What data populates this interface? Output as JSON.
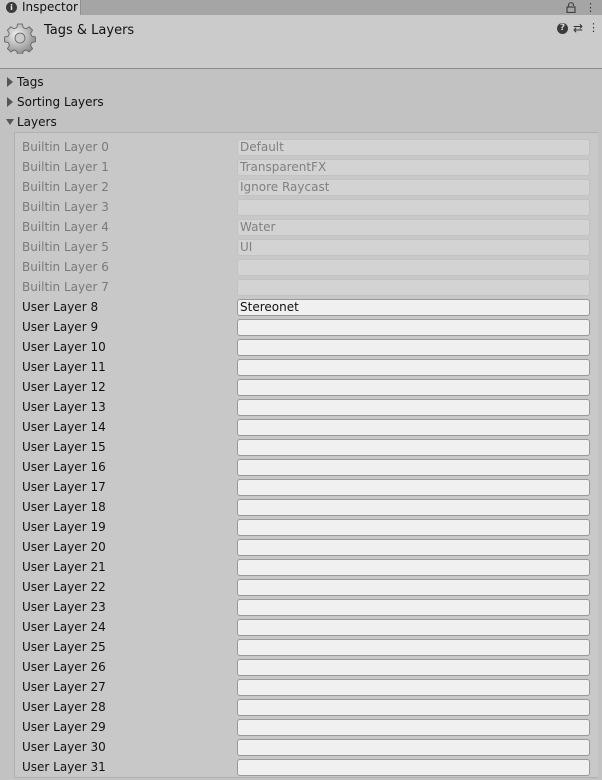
{
  "tab": {
    "label": "Inspector",
    "info_icon": "i",
    "menu_glyph": "⋮"
  },
  "header": {
    "title": "Tags & Layers",
    "help_glyph": "?",
    "preset_glyph": "⇄",
    "menu_glyph": "⋮"
  },
  "sections": {
    "tags": "Tags",
    "sorting_layers": "Sorting Layers",
    "layers": "Layers"
  },
  "layers": [
    {
      "label": "Builtin Layer 0",
      "value": "Default",
      "builtin": true
    },
    {
      "label": "Builtin Layer 1",
      "value": "TransparentFX",
      "builtin": true
    },
    {
      "label": "Builtin Layer 2",
      "value": "Ignore Raycast",
      "builtin": true
    },
    {
      "label": "Builtin Layer 3",
      "value": "",
      "builtin": true
    },
    {
      "label": "Builtin Layer 4",
      "value": "Water",
      "builtin": true
    },
    {
      "label": "Builtin Layer 5",
      "value": "UI",
      "builtin": true
    },
    {
      "label": "Builtin Layer 6",
      "value": "",
      "builtin": true
    },
    {
      "label": "Builtin Layer 7",
      "value": "",
      "builtin": true
    },
    {
      "label": "User Layer 8",
      "value": "Stereonet",
      "builtin": false
    },
    {
      "label": "User Layer 9",
      "value": "",
      "builtin": false
    },
    {
      "label": "User Layer 10",
      "value": "",
      "builtin": false
    },
    {
      "label": "User Layer 11",
      "value": "",
      "builtin": false
    },
    {
      "label": "User Layer 12",
      "value": "",
      "builtin": false
    },
    {
      "label": "User Layer 13",
      "value": "",
      "builtin": false
    },
    {
      "label": "User Layer 14",
      "value": "",
      "builtin": false
    },
    {
      "label": "User Layer 15",
      "value": "",
      "builtin": false
    },
    {
      "label": "User Layer 16",
      "value": "",
      "builtin": false
    },
    {
      "label": "User Layer 17",
      "value": "",
      "builtin": false
    },
    {
      "label": "User Layer 18",
      "value": "",
      "builtin": false
    },
    {
      "label": "User Layer 19",
      "value": "",
      "builtin": false
    },
    {
      "label": "User Layer 20",
      "value": "",
      "builtin": false
    },
    {
      "label": "User Layer 21",
      "value": "",
      "builtin": false
    },
    {
      "label": "User Layer 22",
      "value": "",
      "builtin": false
    },
    {
      "label": "User Layer 23",
      "value": "",
      "builtin": false
    },
    {
      "label": "User Layer 24",
      "value": "",
      "builtin": false
    },
    {
      "label": "User Layer 25",
      "value": "",
      "builtin": false
    },
    {
      "label": "User Layer 26",
      "value": "",
      "builtin": false
    },
    {
      "label": "User Layer 27",
      "value": "",
      "builtin": false
    },
    {
      "label": "User Layer 28",
      "value": "",
      "builtin": false
    },
    {
      "label": "User Layer 29",
      "value": "",
      "builtin": false
    },
    {
      "label": "User Layer 30",
      "value": "",
      "builtin": false
    },
    {
      "label": "User Layer 31",
      "value": "",
      "builtin": false
    }
  ]
}
